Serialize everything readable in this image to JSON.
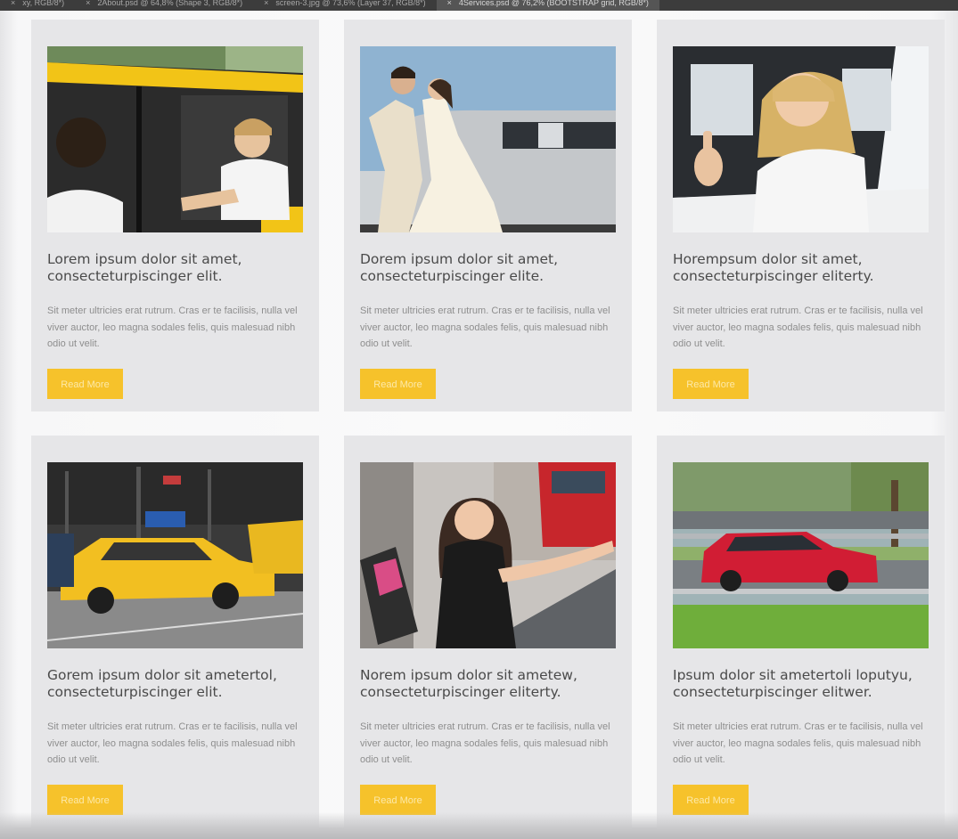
{
  "tabs": [
    {
      "close": "×",
      "label": "xy, RGB/8*)"
    },
    {
      "close": "×",
      "label": "2About.psd @ 64,8% (Shape 3, RGB/8*)"
    },
    {
      "close": "×",
      "label": "screen-3.jpg @ 73,6% (Layer 37, RGB/8*)"
    },
    {
      "close": "×",
      "label": "4Services.psd @ 76,2% (BOOTSTRAP grid, RGB/8*)"
    }
  ],
  "cards": [
    {
      "image": "taxi-driver-woman-photo",
      "title": "Lorem ipsum dolor sit amet, consecteturpiscinger elit.",
      "text": "Sit meter ultricies erat rutrum. Cras er te facilisis, nulla vel viver auctor, leo magna sodales felis, quis malesuad nibh odio ut velit.",
      "button": "Read More"
    },
    {
      "image": "wedding-limousine-photo",
      "title": "Dorem ipsum dolor sit amet, consecteturpiscinger elite.",
      "text": "Sit meter ultricies erat rutrum. Cras er te facilisis, nulla vel viver auctor, leo magna sodales felis, quis malesuad nibh odio ut velit.",
      "button": "Read More"
    },
    {
      "image": "woman-thumbs-up-car-photo",
      "title": "Horempsum dolor sit amet, consecteturpiscinger eliterty.",
      "text": "Sit meter ultricies erat rutrum. Cras er te facilisis, nulla vel viver auctor, leo magna sodales felis, quis malesuad nibh odio ut velit.",
      "button": "Read More"
    },
    {
      "image": "yellow-cabs-street-photo",
      "title": "Gorem ipsum dolor sit ametertol, consecteturpiscinger elit.",
      "text": "Sit meter ultricies erat rutrum. Cras er te facilisis, nulla vel viver auctor, leo magna sodales felis, quis malesuad nibh odio ut velit.",
      "button": "Read More"
    },
    {
      "image": "woman-hailing-taxi-photo",
      "title": "Norem ipsum dolor sit ametew, consecteturpiscinger eliterty.",
      "text": "Sit meter ultricies erat rutrum. Cras er te facilisis, nulla vel viver auctor, leo magna sodales felis, quis malesuad nibh odio ut velit.",
      "button": "Read More"
    },
    {
      "image": "red-car-highway-photo",
      "title": "Ipsum dolor sit ametertoli loputyu, consecteturpiscinger elitwer.",
      "text": "Sit meter ultricies erat rutrum. Cras er te facilisis, nulla vel viver auctor, leo magna sodales felis, quis malesuad nibh odio ut velit.",
      "button": "Read More"
    }
  ],
  "colors": {
    "button": "#f6c22b",
    "card": "#e6e6e8",
    "title": "#4a4a4a",
    "text": "#8e8e8e"
  }
}
